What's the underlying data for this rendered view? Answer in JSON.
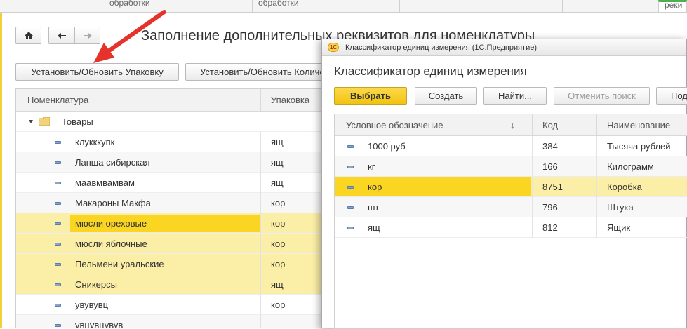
{
  "tabs": [
    "обработки",
    "обработки",
    "реки"
  ],
  "form": {
    "title": "Заполнение дополнительных реквизитов для номенклатуры",
    "btn_set_pack": "Установить/Обновить Упаковку",
    "btn_set_qty": "Установить/Обновить Количество",
    "columns": {
      "nomenclature": "Номенклатура",
      "pack": "Упаковка"
    },
    "group_label": "Товары",
    "rows": [
      {
        "name": "клукккупк",
        "pack": "ящ",
        "selected": false
      },
      {
        "name": "Лапша сибирская",
        "pack": "ящ",
        "selected": false
      },
      {
        "name": "маавмвамвам",
        "pack": "ящ",
        "selected": false
      },
      {
        "name": "Макароны Макфа",
        "pack": "кор",
        "selected": false
      },
      {
        "name": "мюсли ореховые",
        "pack": "кор",
        "selected": true
      },
      {
        "name": "мюсли яблочные",
        "pack": "кор",
        "selected": true
      },
      {
        "name": "Пельмени уральские",
        "pack": "кор",
        "selected": true
      },
      {
        "name": "Сникерсы",
        "pack": "ящ",
        "selected": true
      },
      {
        "name": "увувувц",
        "pack": "кор",
        "selected": false
      },
      {
        "name": "увцувцувув",
        "pack": "",
        "selected": false
      }
    ]
  },
  "dialog": {
    "caption": "Классификатор единиц измерения  (1С:Предприятие)",
    "logo": "1С",
    "title": "Классификатор единиц измерения",
    "btn_select": "Выбрать",
    "btn_create": "Создать",
    "btn_find": "Найти...",
    "btn_cancel_search": "Отменить поиск",
    "btn_more": "Под",
    "columns": {
      "symbol": "Условное обозначение",
      "sort_arrow": "↓",
      "code": "Код",
      "name": "Наименование"
    },
    "rows": [
      {
        "symbol": "1000 руб",
        "code": "384",
        "name": "Тысяча рублей"
      },
      {
        "symbol": "кг",
        "code": "166",
        "name": "Килограмм"
      },
      {
        "symbol": "кор",
        "code": "8751",
        "name": "Коробка"
      },
      {
        "symbol": "шт",
        "code": "796",
        "name": "Штука"
      },
      {
        "symbol": "ящ",
        "code": "812",
        "name": "Ящик"
      }
    ]
  },
  "colors": {
    "accent_yellow": "#fad522",
    "selection": "#fbeea6",
    "arrow_red": "#e5322b"
  }
}
